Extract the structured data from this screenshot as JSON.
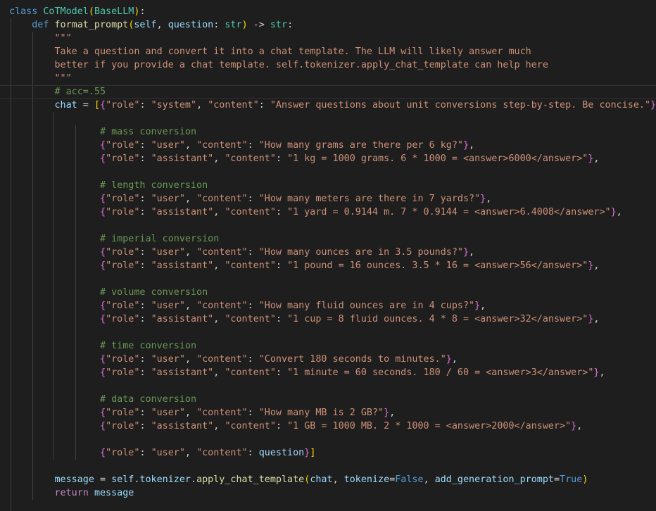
{
  "editor": {
    "colors": {
      "background": "#1e1e1e",
      "default": "#d4d4d4",
      "keyword": "#569cd6",
      "control": "#c586c0",
      "class": "#4ec9b0",
      "function": "#dcdcaa",
      "parameter": "#9cdcfe",
      "string": "#ce9178",
      "comment": "#6a9955",
      "number": "#b5cea8",
      "bracket_level1": "#ffd700",
      "bracket_level2": "#da70d6",
      "bracket_level3": "#179fff"
    },
    "current_line": 6,
    "lines": [
      [
        [
          "kw",
          "class"
        ],
        [
          "op",
          " "
        ],
        [
          "cls",
          "CoTModel"
        ],
        [
          "br1",
          "("
        ],
        [
          "cls",
          "BaseLLM"
        ],
        [
          "br1",
          ")"
        ],
        [
          "op",
          ":"
        ]
      ],
      [
        [
          "op",
          "    "
        ],
        [
          "kw",
          "def"
        ],
        [
          "op",
          " "
        ],
        [
          "fn",
          "format_prompt"
        ],
        [
          "br1",
          "("
        ],
        [
          "param",
          "self"
        ],
        [
          "op",
          ", "
        ],
        [
          "param",
          "question"
        ],
        [
          "op",
          ": "
        ],
        [
          "cls",
          "str"
        ],
        [
          "br1",
          ")"
        ],
        [
          "op",
          " -> "
        ],
        [
          "cls",
          "str"
        ],
        [
          "op",
          ":"
        ]
      ],
      [
        [
          "op",
          "        "
        ],
        [
          "str",
          "\"\"\""
        ]
      ],
      [
        [
          "op",
          "        "
        ],
        [
          "str",
          "Take a question and convert it into a chat template. The LLM will likely answer much"
        ]
      ],
      [
        [
          "op",
          "        "
        ],
        [
          "str",
          "better if you provide a chat template. self.tokenizer.apply_chat_template can help here"
        ]
      ],
      [
        [
          "op",
          "        "
        ],
        [
          "str",
          "\"\"\""
        ]
      ],
      [
        [
          "op",
          "        "
        ],
        [
          "com",
          "# acc=.55"
        ]
      ],
      [
        [
          "op",
          "        "
        ],
        [
          "param",
          "chat"
        ],
        [
          "op",
          " = "
        ],
        [
          "br1",
          "["
        ],
        [
          "br2",
          "{"
        ],
        [
          "str",
          "\"role\""
        ],
        [
          "op",
          ": "
        ],
        [
          "str",
          "\"system\""
        ],
        [
          "op",
          ", "
        ],
        [
          "str",
          "\"content\""
        ],
        [
          "op",
          ": "
        ],
        [
          "str",
          "\"Answer questions about unit conversions step-by-step. Be concise.\""
        ],
        [
          "br2",
          "}"
        ],
        [
          "op",
          ","
        ]
      ],
      [],
      [
        [
          "op",
          "                "
        ],
        [
          "com",
          "# mass conversion"
        ]
      ],
      [
        [
          "op",
          "                "
        ],
        [
          "br2",
          "{"
        ],
        [
          "str",
          "\"role\""
        ],
        [
          "op",
          ": "
        ],
        [
          "str",
          "\"user\""
        ],
        [
          "op",
          ", "
        ],
        [
          "str",
          "\"content\""
        ],
        [
          "op",
          ": "
        ],
        [
          "str",
          "\"How many grams are there per 6 kg?\""
        ],
        [
          "br2",
          "}"
        ],
        [
          "op",
          ","
        ]
      ],
      [
        [
          "op",
          "                "
        ],
        [
          "br2",
          "{"
        ],
        [
          "str",
          "\"role\""
        ],
        [
          "op",
          ": "
        ],
        [
          "str",
          "\"assistant\""
        ],
        [
          "op",
          ", "
        ],
        [
          "str",
          "\"content\""
        ],
        [
          "op",
          ": "
        ],
        [
          "str",
          "\"1 kg = 1000 grams. 6 * 1000 = <answer>6000</answer>\""
        ],
        [
          "br2",
          "}"
        ],
        [
          "op",
          ","
        ]
      ],
      [],
      [
        [
          "op",
          "                "
        ],
        [
          "com",
          "# length conversion"
        ]
      ],
      [
        [
          "op",
          "                "
        ],
        [
          "br2",
          "{"
        ],
        [
          "str",
          "\"role\""
        ],
        [
          "op",
          ": "
        ],
        [
          "str",
          "\"user\""
        ],
        [
          "op",
          ", "
        ],
        [
          "str",
          "\"content\""
        ],
        [
          "op",
          ": "
        ],
        [
          "str",
          "\"How many meters are there in 7 yards?\""
        ],
        [
          "br2",
          "}"
        ],
        [
          "op",
          ","
        ]
      ],
      [
        [
          "op",
          "                "
        ],
        [
          "br2",
          "{"
        ],
        [
          "str",
          "\"role\""
        ],
        [
          "op",
          ": "
        ],
        [
          "str",
          "\"assistant\""
        ],
        [
          "op",
          ", "
        ],
        [
          "str",
          "\"content\""
        ],
        [
          "op",
          ": "
        ],
        [
          "str",
          "\"1 yard = 0.9144 m. 7 * 0.9144 = <answer>6.4008</answer>\""
        ],
        [
          "br2",
          "}"
        ],
        [
          "op",
          ","
        ]
      ],
      [],
      [
        [
          "op",
          "                "
        ],
        [
          "com",
          "# imperial conversion"
        ]
      ],
      [
        [
          "op",
          "                "
        ],
        [
          "br2",
          "{"
        ],
        [
          "str",
          "\"role\""
        ],
        [
          "op",
          ": "
        ],
        [
          "str",
          "\"user\""
        ],
        [
          "op",
          ", "
        ],
        [
          "str",
          "\"content\""
        ],
        [
          "op",
          ": "
        ],
        [
          "str",
          "\"How many ounces are in 3.5 pounds?\""
        ],
        [
          "br2",
          "}"
        ],
        [
          "op",
          ","
        ]
      ],
      [
        [
          "op",
          "                "
        ],
        [
          "br2",
          "{"
        ],
        [
          "str",
          "\"role\""
        ],
        [
          "op",
          ": "
        ],
        [
          "str",
          "\"assistant\""
        ],
        [
          "op",
          ", "
        ],
        [
          "str",
          "\"content\""
        ],
        [
          "op",
          ": "
        ],
        [
          "str",
          "\"1 pound = 16 ounces. 3.5 * 16 = <answer>56</answer>\""
        ],
        [
          "br2",
          "}"
        ],
        [
          "op",
          ","
        ]
      ],
      [],
      [
        [
          "op",
          "                "
        ],
        [
          "com",
          "# volume conversion"
        ]
      ],
      [
        [
          "op",
          "                "
        ],
        [
          "br2",
          "{"
        ],
        [
          "str",
          "\"role\""
        ],
        [
          "op",
          ": "
        ],
        [
          "str",
          "\"user\""
        ],
        [
          "op",
          ", "
        ],
        [
          "str",
          "\"content\""
        ],
        [
          "op",
          ": "
        ],
        [
          "str",
          "\"How many fluid ounces are in 4 cups?\""
        ],
        [
          "br2",
          "}"
        ],
        [
          "op",
          ","
        ]
      ],
      [
        [
          "op",
          "                "
        ],
        [
          "br2",
          "{"
        ],
        [
          "str",
          "\"role\""
        ],
        [
          "op",
          ": "
        ],
        [
          "str",
          "\"assistant\""
        ],
        [
          "op",
          ", "
        ],
        [
          "str",
          "\"content\""
        ],
        [
          "op",
          ": "
        ],
        [
          "str",
          "\"1 cup = 8 fluid ounces. 4 * 8 = <answer>32</answer>\""
        ],
        [
          "br2",
          "}"
        ],
        [
          "op",
          ","
        ]
      ],
      [],
      [
        [
          "op",
          "                "
        ],
        [
          "com",
          "# time conversion"
        ]
      ],
      [
        [
          "op",
          "                "
        ],
        [
          "br2",
          "{"
        ],
        [
          "str",
          "\"role\""
        ],
        [
          "op",
          ": "
        ],
        [
          "str",
          "\"user\""
        ],
        [
          "op",
          ", "
        ],
        [
          "str",
          "\"content\""
        ],
        [
          "op",
          ": "
        ],
        [
          "str",
          "\"Convert 180 seconds to minutes.\""
        ],
        [
          "br2",
          "}"
        ],
        [
          "op",
          ","
        ]
      ],
      [
        [
          "op",
          "                "
        ],
        [
          "br2",
          "{"
        ],
        [
          "str",
          "\"role\""
        ],
        [
          "op",
          ": "
        ],
        [
          "str",
          "\"assistant\""
        ],
        [
          "op",
          ", "
        ],
        [
          "str",
          "\"content\""
        ],
        [
          "op",
          ": "
        ],
        [
          "str",
          "\"1 minute = 60 seconds. 180 / 60 = <answer>3</answer>\""
        ],
        [
          "br2",
          "}"
        ],
        [
          "op",
          ","
        ]
      ],
      [],
      [
        [
          "op",
          "                "
        ],
        [
          "com",
          "# data conversion"
        ]
      ],
      [
        [
          "op",
          "                "
        ],
        [
          "br2",
          "{"
        ],
        [
          "str",
          "\"role\""
        ],
        [
          "op",
          ": "
        ],
        [
          "str",
          "\"user\""
        ],
        [
          "op",
          ", "
        ],
        [
          "str",
          "\"content\""
        ],
        [
          "op",
          ": "
        ],
        [
          "str",
          "\"How many MB is 2 GB?\""
        ],
        [
          "br2",
          "}"
        ],
        [
          "op",
          ","
        ]
      ],
      [
        [
          "op",
          "                "
        ],
        [
          "br2",
          "{"
        ],
        [
          "str",
          "\"role\""
        ],
        [
          "op",
          ": "
        ],
        [
          "str",
          "\"assistant\""
        ],
        [
          "op",
          ", "
        ],
        [
          "str",
          "\"content\""
        ],
        [
          "op",
          ": "
        ],
        [
          "str",
          "\"1 GB = 1000 MB. 2 * 1000 = <answer>2000</answer>\""
        ],
        [
          "br2",
          "}"
        ],
        [
          "op",
          ","
        ]
      ],
      [],
      [
        [
          "op",
          "                "
        ],
        [
          "br2",
          "{"
        ],
        [
          "str",
          "\"role\""
        ],
        [
          "op",
          ": "
        ],
        [
          "str",
          "\"user\""
        ],
        [
          "op",
          ", "
        ],
        [
          "str",
          "\"content\""
        ],
        [
          "op",
          ": "
        ],
        [
          "param",
          "question"
        ],
        [
          "br2",
          "}"
        ],
        [
          "br1",
          "]"
        ]
      ],
      [],
      [
        [
          "op",
          "        "
        ],
        [
          "param",
          "message"
        ],
        [
          "op",
          " = "
        ],
        [
          "param",
          "self"
        ],
        [
          "op",
          "."
        ],
        [
          "param",
          "tokenizer"
        ],
        [
          "op",
          "."
        ],
        [
          "fn",
          "apply_chat_template"
        ],
        [
          "br1",
          "("
        ],
        [
          "param",
          "chat"
        ],
        [
          "op",
          ", "
        ],
        [
          "param",
          "tokenize"
        ],
        [
          "op",
          "="
        ],
        [
          "kw",
          "False"
        ],
        [
          "op",
          ", "
        ],
        [
          "param",
          "add_generation_prompt"
        ],
        [
          "op",
          "="
        ],
        [
          "kw",
          "True"
        ],
        [
          "br1",
          ")"
        ]
      ],
      [
        [
          "op",
          "        "
        ],
        [
          "ctrl",
          "return"
        ],
        [
          "op",
          " "
        ],
        [
          "param",
          "message"
        ]
      ]
    ]
  }
}
